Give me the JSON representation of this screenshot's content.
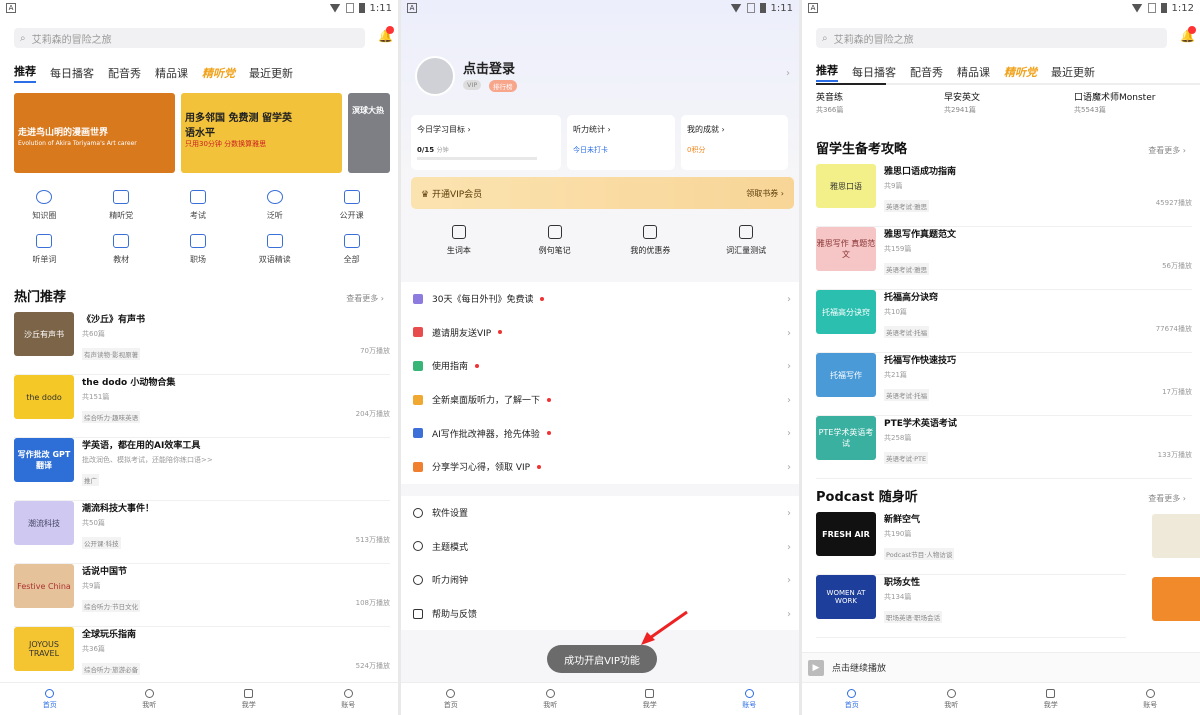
{
  "panel1": {
    "status": {
      "time": "1:11",
      "app_icon": "A"
    },
    "search_placeholder": "艾莉森的冒险之旅",
    "tabs": [
      "推荐",
      "每日播客",
      "配音秀",
      "精品课",
      "精听党",
      "最近更新"
    ],
    "banners": [
      {
        "text": "走进鸟山明的漫画世界",
        "sub": "Evolution of Akira Toriyama's Art career",
        "color": "#d9791e"
      },
      {
        "text": "用多邻国 免费测 留学英语水平",
        "sub": "只用30分钟 分数换算雅思",
        "color": "#f2c23a"
      },
      {
        "text": "溟球大热",
        "sub": "",
        "color": "#7d7f85"
      }
    ],
    "grid": [
      {
        "label": "知识圈",
        "icon": "circle-icon"
      },
      {
        "label": "精听党",
        "icon": "headphone-icon"
      },
      {
        "label": "考试",
        "icon": "exam-icon"
      },
      {
        "label": "泛听",
        "icon": "globe-icon"
      },
      {
        "label": "公开课",
        "icon": "graduation-icon"
      },
      {
        "label": "听单词",
        "icon": "word-icon"
      },
      {
        "label": "教材",
        "icon": "book-icon"
      },
      {
        "label": "职场",
        "icon": "briefcase-icon"
      },
      {
        "label": "双语精读",
        "icon": "bilingual-icon"
      },
      {
        "label": "全部",
        "icon": "grid-icon"
      }
    ],
    "section_title": "热门推荐",
    "more": "查看更多 ›",
    "items": [
      {
        "title": "《沙丘》有声书",
        "count": "共60篇",
        "tag": "有声读物·影视原著",
        "plays": "70万播放",
        "thumb": "沙丘有声书",
        "color": "#7b6448"
      },
      {
        "title": "the dodo 小动物合集",
        "count": "共151篇",
        "tag": "综合听力·趣味英语",
        "plays": "204万播放",
        "thumb": "the dodo",
        "color": "#f4c826"
      },
      {
        "title": "学英语，都在用的AI效率工具",
        "count": "批改润色、模拟考试，还能陪你练口语>>",
        "tag": "推广",
        "plays": "",
        "thumb": "写作批改 GPT翻译",
        "color": "#2d6fd6"
      },
      {
        "title": "潮流科技大事件！",
        "count": "共50篇",
        "tag": "公开课·科技",
        "plays": "513万播放",
        "thumb": "潮流科技",
        "color": "#cfc8f0"
      },
      {
        "title": "话说中国节",
        "count": "共9篇",
        "tag": "综合听力·节日文化",
        "plays": "108万播放",
        "thumb": "Festive China",
        "color": "#e6c29a"
      },
      {
        "title": "全球玩乐指南",
        "count": "共36篇",
        "tag": "综合听力·旅游必备",
        "plays": "524万播放",
        "thumb": "JOYOUS TRAVEL",
        "color": "#f5c531"
      }
    ],
    "nav": [
      "首页",
      "我听",
      "我学",
      "账号"
    ]
  },
  "panel2": {
    "status": {
      "time": "1:11",
      "app_icon": "A"
    },
    "login": "点击登录",
    "vip_badge": "VIP",
    "rank_badge": "排行榜",
    "cards": [
      {
        "title": "今日学习目标 ›",
        "value": "0/15",
        "unit": "分钟"
      },
      {
        "title": "听力统计 ›",
        "value": "今日未打卡"
      },
      {
        "title": "我的成就 ›",
        "value": "0积分"
      }
    ],
    "vip_bar": {
      "left": "开通VIP会员",
      "right": "领取书券 ›"
    },
    "tools": [
      {
        "label": "生词本",
        "icon": "notebook-icon"
      },
      {
        "label": "例句笔记",
        "icon": "note-icon"
      },
      {
        "label": "我的优惠券",
        "icon": "coupon-icon"
      },
      {
        "label": "词汇量测试",
        "icon": "test-icon"
      }
    ],
    "menu1": [
      {
        "label": "30天《每日外刊》免费读",
        "color": "#8e7be0",
        "dot": true
      },
      {
        "label": "邀请朋友送VIP",
        "color": "#e84c4c",
        "dot": true
      },
      {
        "label": "使用指南",
        "color": "#37b577",
        "dot": true
      },
      {
        "label": "全新桌面版听力，了解一下",
        "color": "#f0a830",
        "dot": true
      },
      {
        "label": "AI写作批改神器，抢先体验",
        "color": "#3c6fd8",
        "dot": true
      },
      {
        "label": "分享学习心得，领取 VIP",
        "color": "#f08030",
        "dot": true
      }
    ],
    "menu2": [
      {
        "label": "软件设置",
        "icon": "settings-icon"
      },
      {
        "label": "主题模式",
        "icon": "moon-icon"
      },
      {
        "label": "听力闹钟",
        "icon": "alarm-icon"
      },
      {
        "label": "帮助与反馈",
        "icon": "feedback-icon"
      }
    ],
    "toast": "成功开启VIP功能",
    "nav": [
      "首页",
      "我听",
      "我学",
      "账号"
    ]
  },
  "panel3": {
    "status": {
      "time": "1:12",
      "app_icon": "A"
    },
    "search_placeholder": "艾莉森的冒险之旅",
    "tabs": [
      "推荐",
      "每日播客",
      "配音秀",
      "精品课",
      "精听党",
      "最近更新"
    ],
    "subtabs": [
      {
        "title": "英音练",
        "count": "共366篇"
      },
      {
        "title": "早安英文",
        "count": "共2941篇"
      },
      {
        "title": "口语魔术师Monster",
        "count": "共5543篇"
      }
    ],
    "section1_title": "留学生备考攻略",
    "section1_more": "查看更多 ›",
    "items": [
      {
        "title": "雅思口语成功指南",
        "count": "共9篇",
        "tag": "英语考试·雅思",
        "plays": "45927播放",
        "thumb": "雅思口语",
        "color": "#f3f08a"
      },
      {
        "title": "雅思写作真题范文",
        "count": "共159篇",
        "tag": "英语考试·雅思",
        "plays": "56万播放",
        "thumb": "雅思写作 真题范文",
        "color": "#f6c6c6"
      },
      {
        "title": "托福高分诀窍",
        "count": "共10篇",
        "tag": "英语考试·托福",
        "plays": "77674播放",
        "thumb": "托福高分诀窍",
        "color": "#2bbfb0"
      },
      {
        "title": "托福写作快速技巧",
        "count": "共21篇",
        "tag": "英语考试·托福",
        "plays": "17万播放",
        "thumb": "托福写作",
        "color": "#4a9ad8"
      },
      {
        "title": "PTE学术英语考试",
        "count": "共258篇",
        "tag": "英语考试·PTE",
        "plays": "133万播放",
        "thumb": "PTE学术英语考试",
        "color": "#3ab0a0"
      }
    ],
    "section2_title": "Podcast 随身听",
    "section2_more": "查看更多 ›",
    "podcasts": [
      {
        "title": "新鲜空气",
        "count": "共190篇",
        "tag": "Podcast节目·人物访谈",
        "thumb": "FRESH AIR",
        "color": "#111"
      },
      {
        "title": "职场女性",
        "count": "共134篇",
        "tag": "职场英语·职场会话",
        "thumb": "WOMEN AT WORK",
        "color": "#1d3e9a"
      }
    ],
    "player": "点击继续播放",
    "nav": [
      "首页",
      "我听",
      "我学",
      "账号"
    ]
  },
  "colors": {
    "accent": "#2b6de5",
    "badge": "#ff3333",
    "vip": "#f8d597"
  }
}
